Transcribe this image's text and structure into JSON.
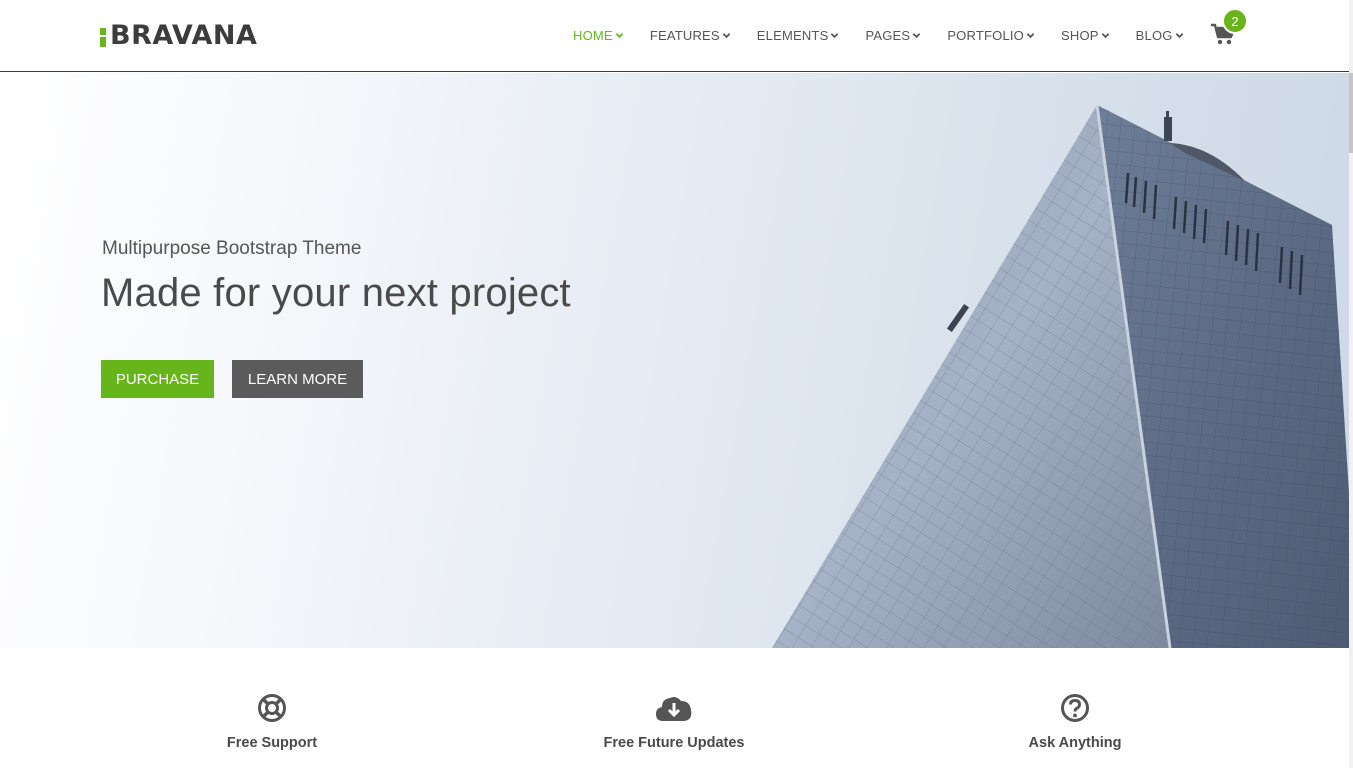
{
  "brand": {
    "name": "BRAVANA",
    "accent_color": "#67b51a"
  },
  "nav": {
    "items": [
      {
        "label": "HOME",
        "active": true
      },
      {
        "label": "FEATURES",
        "active": false
      },
      {
        "label": "ELEMENTS",
        "active": false
      },
      {
        "label": "PAGES",
        "active": false
      },
      {
        "label": "PORTFOLIO",
        "active": false
      },
      {
        "label": "SHOP",
        "active": false
      },
      {
        "label": "BLOG",
        "active": false
      }
    ],
    "cart_icon": "shopping-cart-icon",
    "cart_count": "2"
  },
  "hero": {
    "subtitle": "Multipurpose Bootstrap Theme",
    "title": "Made for your next project",
    "purchase_label": "PURCHASE",
    "learn_more_label": "LEARN MORE",
    "purchase_color": "#67b51a",
    "learn_more_color": "#5b5b5b"
  },
  "features": [
    {
      "icon": "life-ring-icon",
      "label": "Free Support"
    },
    {
      "icon": "cloud-download-icon",
      "label": "Free Future Updates"
    },
    {
      "icon": "question-circle-icon",
      "label": "Ask Anything"
    }
  ]
}
